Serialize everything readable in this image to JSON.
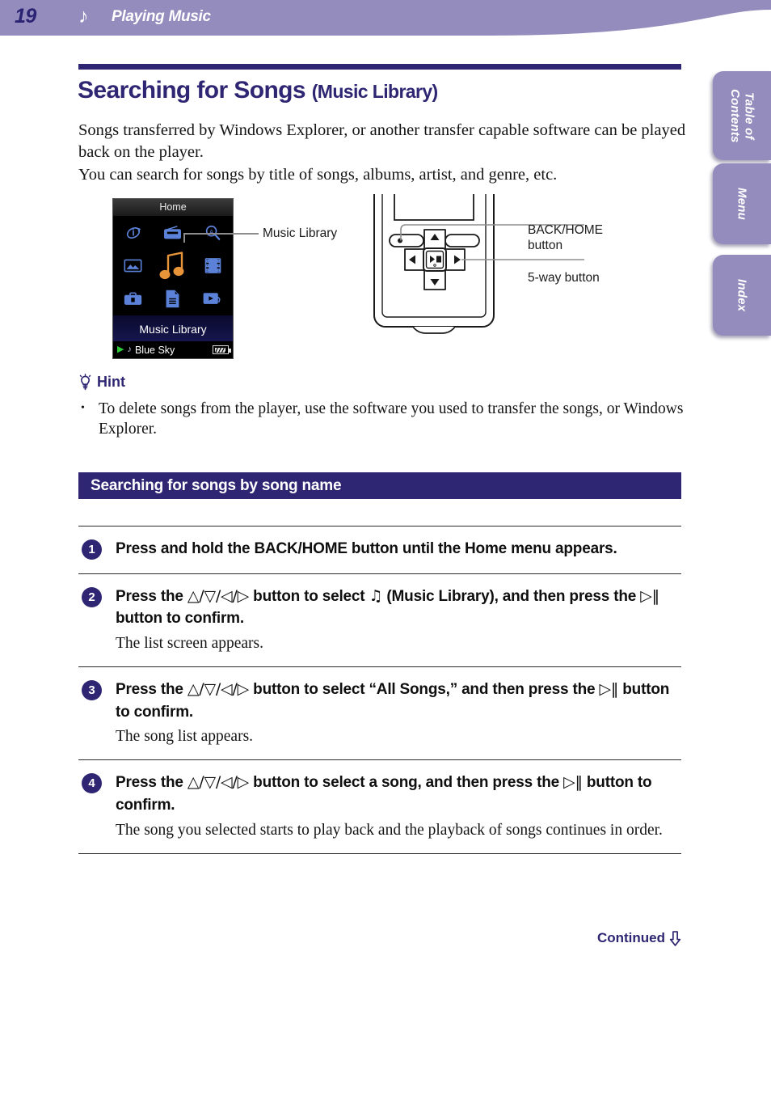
{
  "header": {
    "page_number": "19",
    "note_icon": "music-note-icon",
    "title": "Playing Music",
    "bg_color": "#938cbd",
    "number_color": "#2a2272"
  },
  "side_tabs": [
    {
      "label": "Table of\nContents",
      "name": "table-of-contents"
    },
    {
      "label": "Menu",
      "name": "menu"
    },
    {
      "label": "Index",
      "name": "index"
    }
  ],
  "title": {
    "main": "Searching for Songs ",
    "sub": "(Music Library)",
    "accent_color": "#2e2673"
  },
  "intro": "Songs transferred by Windows Explorer, or another transfer capable software can be played back on the player.\nYou can search for songs by title of songs, albums, artist, and genre, etc.",
  "figure": {
    "lcd": {
      "title": "Home",
      "icons": [
        "intelligent-shuffle-icon",
        "fm-radio-icon",
        "search-icon",
        "photo-library-icon",
        "music-library-icon",
        "video-library-icon",
        "settings-toolbox-icon",
        "playlists-icon",
        "now-playing-icon"
      ],
      "selected_index": 4,
      "selected_color": "#e8953a",
      "icon_color": "#5b82d8",
      "label": "Music Library",
      "status": {
        "play_icon": "play-icon",
        "note_icon": "music-note-icon",
        "song": "Blue Sky",
        "battery_icon": "battery-icon"
      }
    },
    "callouts": {
      "music_library": "Music Library",
      "back_home": "BACK/HOME\nbutton",
      "five_way": "5-way button"
    }
  },
  "hint": {
    "icon": "lightbulb-icon",
    "heading": "Hint",
    "bullet": "•",
    "text": "To delete songs from the player, use the software you used to transfer the songs, or Windows Explorer."
  },
  "section": {
    "heading": "Searching for songs by song name",
    "bg_color": "#2e2673"
  },
  "steps": [
    {
      "number": "1",
      "main": "Press and hold the BACK/HOME button until the Home menu appears.",
      "sub": ""
    },
    {
      "number": "2",
      "main_parts": [
        "Press the ",
        "△/▽/◁/▷",
        " button to select ",
        "♫",
        " (Music Library), and then press the ",
        "▷‖",
        " button to confirm."
      ],
      "sub": "The list screen appears."
    },
    {
      "number": "3",
      "main_parts": [
        "Press the ",
        "△/▽/◁/▷",
        " button to select “All Songs,” and then press the ",
        "▷‖",
        " button to confirm."
      ],
      "sub": "The song list appears."
    },
    {
      "number": "4",
      "main_parts": [
        "Press the ",
        "△/▽/◁/▷",
        " button to select a song, and then press the ",
        "▷‖",
        " button to confirm."
      ],
      "sub": "The song you selected starts to play back and the playback of songs continues in order."
    }
  ],
  "footer": {
    "continued": "Continued",
    "arrow_icon": "arrow-down-icon"
  }
}
